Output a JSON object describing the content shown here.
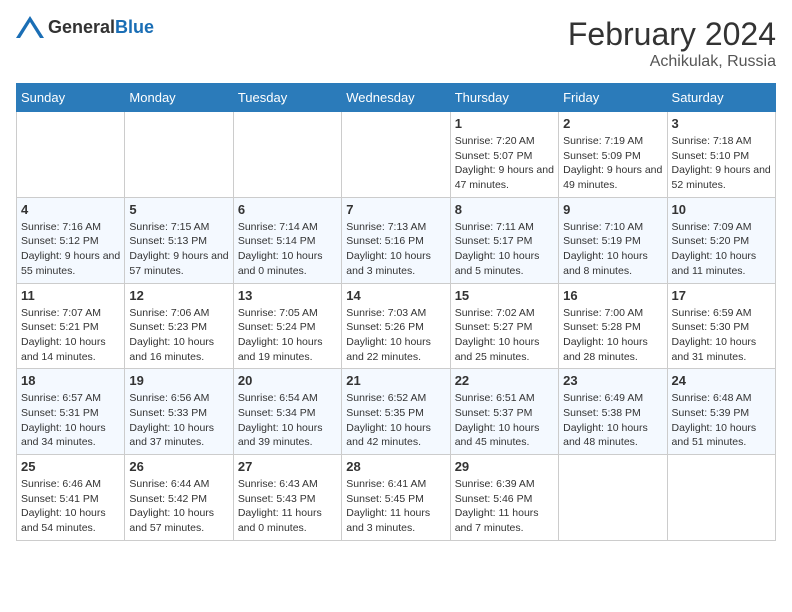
{
  "header": {
    "logo_general": "General",
    "logo_blue": "Blue",
    "month_year": "February 2024",
    "location": "Achikulak, Russia"
  },
  "days_of_week": [
    "Sunday",
    "Monday",
    "Tuesday",
    "Wednesday",
    "Thursday",
    "Friday",
    "Saturday"
  ],
  "weeks": [
    [
      {
        "day": "",
        "info": ""
      },
      {
        "day": "",
        "info": ""
      },
      {
        "day": "",
        "info": ""
      },
      {
        "day": "",
        "info": ""
      },
      {
        "day": "1",
        "info": "Sunrise: 7:20 AM\nSunset: 5:07 PM\nDaylight: 9 hours and 47 minutes."
      },
      {
        "day": "2",
        "info": "Sunrise: 7:19 AM\nSunset: 5:09 PM\nDaylight: 9 hours and 49 minutes."
      },
      {
        "day": "3",
        "info": "Sunrise: 7:18 AM\nSunset: 5:10 PM\nDaylight: 9 hours and 52 minutes."
      }
    ],
    [
      {
        "day": "4",
        "info": "Sunrise: 7:16 AM\nSunset: 5:12 PM\nDaylight: 9 hours and 55 minutes."
      },
      {
        "day": "5",
        "info": "Sunrise: 7:15 AM\nSunset: 5:13 PM\nDaylight: 9 hours and 57 minutes."
      },
      {
        "day": "6",
        "info": "Sunrise: 7:14 AM\nSunset: 5:14 PM\nDaylight: 10 hours and 0 minutes."
      },
      {
        "day": "7",
        "info": "Sunrise: 7:13 AM\nSunset: 5:16 PM\nDaylight: 10 hours and 3 minutes."
      },
      {
        "day": "8",
        "info": "Sunrise: 7:11 AM\nSunset: 5:17 PM\nDaylight: 10 hours and 5 minutes."
      },
      {
        "day": "9",
        "info": "Sunrise: 7:10 AM\nSunset: 5:19 PM\nDaylight: 10 hours and 8 minutes."
      },
      {
        "day": "10",
        "info": "Sunrise: 7:09 AM\nSunset: 5:20 PM\nDaylight: 10 hours and 11 minutes."
      }
    ],
    [
      {
        "day": "11",
        "info": "Sunrise: 7:07 AM\nSunset: 5:21 PM\nDaylight: 10 hours and 14 minutes."
      },
      {
        "day": "12",
        "info": "Sunrise: 7:06 AM\nSunset: 5:23 PM\nDaylight: 10 hours and 16 minutes."
      },
      {
        "day": "13",
        "info": "Sunrise: 7:05 AM\nSunset: 5:24 PM\nDaylight: 10 hours and 19 minutes."
      },
      {
        "day": "14",
        "info": "Sunrise: 7:03 AM\nSunset: 5:26 PM\nDaylight: 10 hours and 22 minutes."
      },
      {
        "day": "15",
        "info": "Sunrise: 7:02 AM\nSunset: 5:27 PM\nDaylight: 10 hours and 25 minutes."
      },
      {
        "day": "16",
        "info": "Sunrise: 7:00 AM\nSunset: 5:28 PM\nDaylight: 10 hours and 28 minutes."
      },
      {
        "day": "17",
        "info": "Sunrise: 6:59 AM\nSunset: 5:30 PM\nDaylight: 10 hours and 31 minutes."
      }
    ],
    [
      {
        "day": "18",
        "info": "Sunrise: 6:57 AM\nSunset: 5:31 PM\nDaylight: 10 hours and 34 minutes."
      },
      {
        "day": "19",
        "info": "Sunrise: 6:56 AM\nSunset: 5:33 PM\nDaylight: 10 hours and 37 minutes."
      },
      {
        "day": "20",
        "info": "Sunrise: 6:54 AM\nSunset: 5:34 PM\nDaylight: 10 hours and 39 minutes."
      },
      {
        "day": "21",
        "info": "Sunrise: 6:52 AM\nSunset: 5:35 PM\nDaylight: 10 hours and 42 minutes."
      },
      {
        "day": "22",
        "info": "Sunrise: 6:51 AM\nSunset: 5:37 PM\nDaylight: 10 hours and 45 minutes."
      },
      {
        "day": "23",
        "info": "Sunrise: 6:49 AM\nSunset: 5:38 PM\nDaylight: 10 hours and 48 minutes."
      },
      {
        "day": "24",
        "info": "Sunrise: 6:48 AM\nSunset: 5:39 PM\nDaylight: 10 hours and 51 minutes."
      }
    ],
    [
      {
        "day": "25",
        "info": "Sunrise: 6:46 AM\nSunset: 5:41 PM\nDaylight: 10 hours and 54 minutes."
      },
      {
        "day": "26",
        "info": "Sunrise: 6:44 AM\nSunset: 5:42 PM\nDaylight: 10 hours and 57 minutes."
      },
      {
        "day": "27",
        "info": "Sunrise: 6:43 AM\nSunset: 5:43 PM\nDaylight: 11 hours and 0 minutes."
      },
      {
        "day": "28",
        "info": "Sunrise: 6:41 AM\nSunset: 5:45 PM\nDaylight: 11 hours and 3 minutes."
      },
      {
        "day": "29",
        "info": "Sunrise: 6:39 AM\nSunset: 5:46 PM\nDaylight: 11 hours and 7 minutes."
      },
      {
        "day": "",
        "info": ""
      },
      {
        "day": "",
        "info": ""
      }
    ]
  ]
}
